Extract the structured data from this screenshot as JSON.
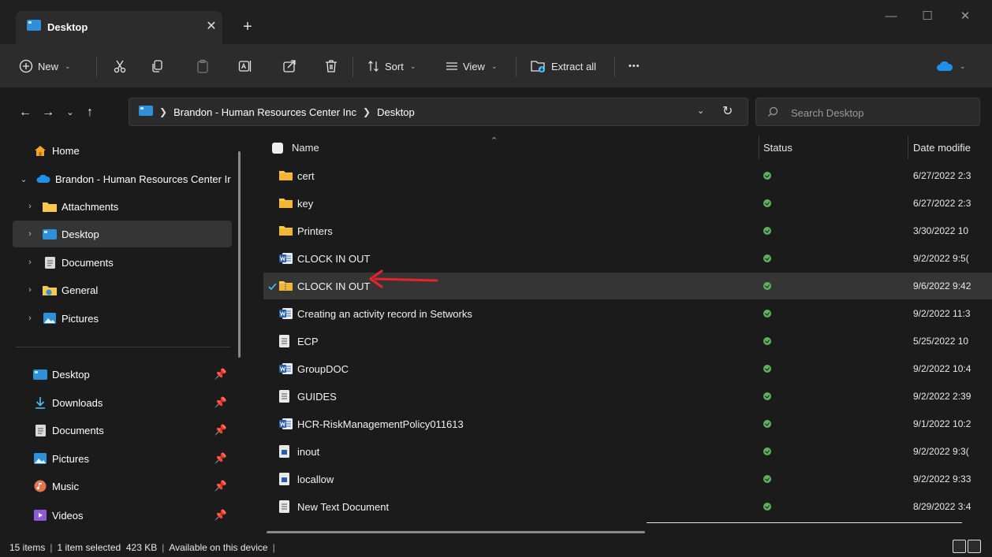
{
  "window": {
    "tab_title": "Desktop",
    "tab_close": "✕",
    "new_tab": "+",
    "minimize": "—",
    "maximize": "☐",
    "close": "✕"
  },
  "toolbar": {
    "new_label": "New",
    "sort_label": "Sort",
    "view_label": "View",
    "extract_label": "Extract all",
    "more_label": "•••"
  },
  "address": {
    "crumbs": [
      "Brandon - Human Resources Center Inc",
      "Desktop"
    ],
    "search_placeholder": "Search Desktop"
  },
  "sidebar": {
    "items": [
      {
        "label": "Home",
        "icon": "home-icon"
      },
      {
        "label": "Brandon - Human Resources Center Ir",
        "icon": "cloud-icon"
      },
      {
        "label": "Attachments",
        "icon": "folder-icon"
      },
      {
        "label": "Desktop",
        "icon": "desktop-icon"
      },
      {
        "label": "Documents",
        "icon": "document-icon"
      },
      {
        "label": "General",
        "icon": "shared-folder-icon"
      },
      {
        "label": "Pictures",
        "icon": "pictures-icon"
      }
    ],
    "quick_access": [
      {
        "label": "Desktop",
        "icon": "desktop-icon"
      },
      {
        "label": "Downloads",
        "icon": "download-icon"
      },
      {
        "label": "Documents",
        "icon": "document-icon"
      },
      {
        "label": "Pictures",
        "icon": "pictures-icon"
      },
      {
        "label": "Music",
        "icon": "music-icon"
      },
      {
        "label": "Videos",
        "icon": "videos-icon"
      }
    ]
  },
  "columns": {
    "name": "Name",
    "status": "Status",
    "date": "Date modifie"
  },
  "files": [
    {
      "name": "cert",
      "type": "folder",
      "date": "6/27/2022 2:3"
    },
    {
      "name": "key",
      "type": "folder",
      "date": "6/27/2022 2:3"
    },
    {
      "name": "Printers",
      "type": "folder",
      "date": "3/30/2022 10"
    },
    {
      "name": "CLOCK IN OUT",
      "type": "word",
      "date": "9/2/2022 9:5("
    },
    {
      "name": "CLOCK IN OUT",
      "type": "zip",
      "date": "9/6/2022 9:42",
      "selected": true
    },
    {
      "name": "Creating an activity record in Setworks",
      "type": "word",
      "date": "9/2/2022 11:3"
    },
    {
      "name": "ECP",
      "type": "text",
      "date": "5/25/2022 10"
    },
    {
      "name": "GroupDOC",
      "type": "word",
      "date": "9/2/2022 10:4"
    },
    {
      "name": "GUIDES",
      "type": "text",
      "date": "9/2/2022 2:39"
    },
    {
      "name": "HCR-RiskManagementPolicy011613",
      "type": "word",
      "date": "9/1/2022 10:2"
    },
    {
      "name": "inout",
      "type": "doc",
      "date": "9/2/2022 9:3("
    },
    {
      "name": "locallow",
      "type": "doc",
      "date": "9/2/2022 9:33"
    },
    {
      "name": "New Text Document",
      "type": "text",
      "date": "8/29/2022 3:4"
    }
  ],
  "status": {
    "items": "15 items",
    "selected": "1 item selected  423 KB",
    "availability": "Available on this device"
  },
  "colors": {
    "accent_blue": "#4cc2ff",
    "folder_yellow": "#f7c948",
    "status_green": "#5fb15f",
    "annotation_red": "#e8232a"
  }
}
